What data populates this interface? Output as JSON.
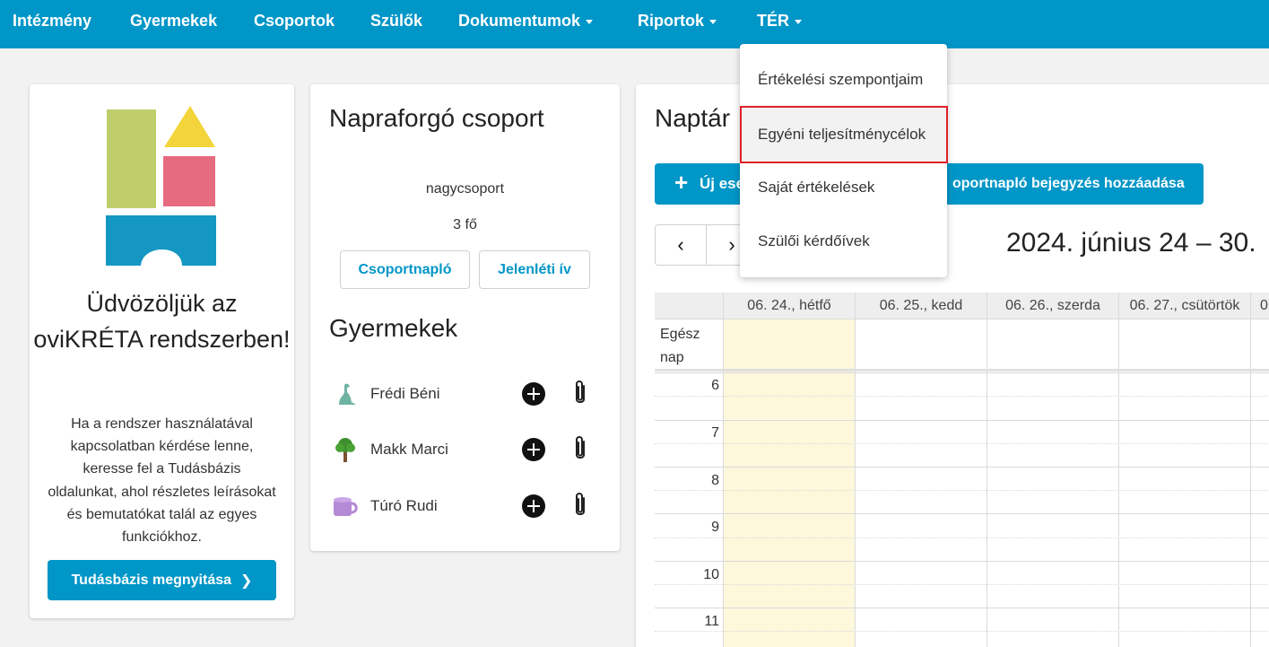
{
  "nav": {
    "items": [
      {
        "label": "Intézmény",
        "dropdown": false
      },
      {
        "label": "Gyermekek",
        "dropdown": false
      },
      {
        "label": "Csoportok",
        "dropdown": false
      },
      {
        "label": "Szülők",
        "dropdown": false
      },
      {
        "label": "Dokumentumok",
        "dropdown": true
      },
      {
        "label": "Riportok",
        "dropdown": true
      },
      {
        "label": "TÉR",
        "dropdown": true
      }
    ]
  },
  "dropdown": {
    "items": [
      {
        "label": "Értékelési szempontjaim"
      },
      {
        "label": "Egyéni teljesítménycélok",
        "highlighted": true
      },
      {
        "label": "Saját értékelések"
      },
      {
        "label": "Szülői kérdőívek"
      }
    ]
  },
  "welcome": {
    "title": "Üdvözöljük az oviKRÉTA rendszerben!",
    "text": "Ha a rendszer használatával kapcsolatban kérdése lenne, keresse fel a Tudásbázis oldalunkat, ahol részletes leírásokat és bemutatókat talál az egyes funkciókhoz.",
    "button_label": "Tudásbázis megnyitása"
  },
  "group": {
    "title": "Napraforgó csoport",
    "type": "nagycsoport",
    "count": "3 fő",
    "buttons": {
      "journal": "Csoportnapló",
      "attendance": "Jelenléti ív"
    },
    "children_title": "Gyermekek",
    "children": [
      {
        "name": "Frédi Béni",
        "avatar": "dinosaur-icon"
      },
      {
        "name": "Makk Marci",
        "avatar": "tree-icon"
      },
      {
        "name": "Túró Rudi",
        "avatar": "mug-icon"
      }
    ]
  },
  "calendar": {
    "title": "Naptár",
    "add_event_label": "Új ese",
    "add_journal_label": "oportnapló bejegyzés hozzáadása",
    "prev_label": "‹",
    "next_label": "›",
    "week_range": "2024. június 24 – 30.",
    "days": [
      "06. 24., hétfő",
      "06. 25., kedd",
      "06. 26., szerda",
      "06. 27., csütörtök",
      "0"
    ],
    "all_day_label": "Egész nap",
    "hours": [
      "6",
      "7",
      "8",
      "9",
      "10",
      "11"
    ]
  },
  "colors": {
    "primary": "#0096c7",
    "today": "#fdf7dc",
    "highlight_border": "#e0202a"
  }
}
